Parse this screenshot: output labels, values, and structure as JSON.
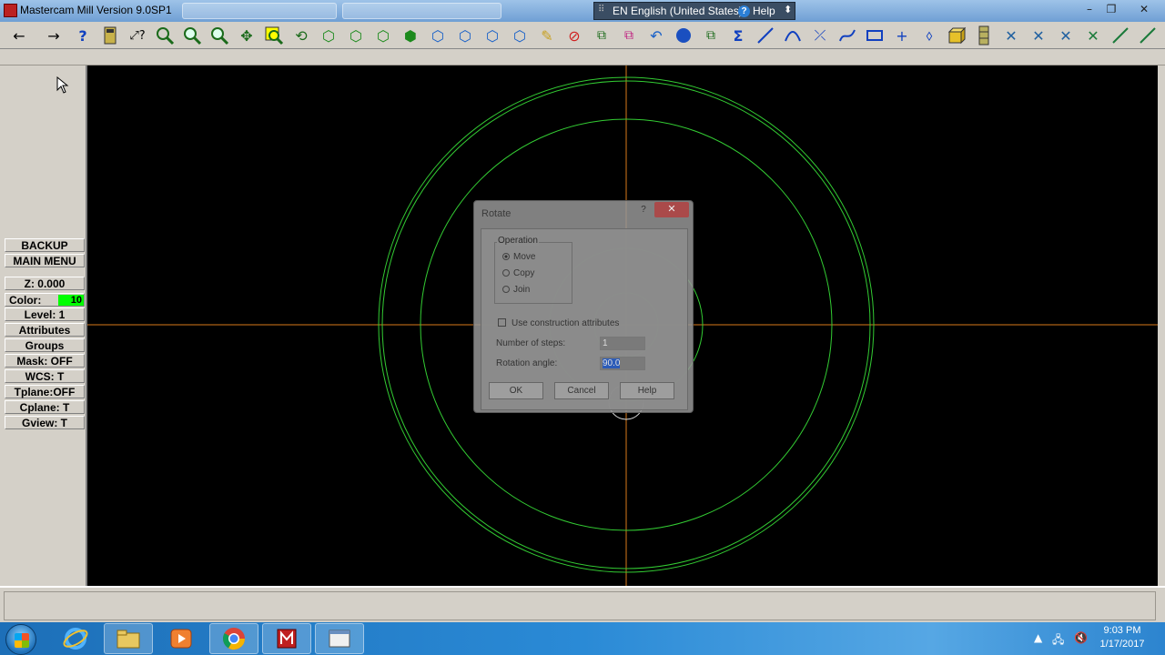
{
  "window": {
    "title": "Mastercam Mill Version 9.0SP1",
    "language": "EN English (United States)",
    "help": "Help",
    "controls": [
      "minimize-icon",
      "restore-icon",
      "close-icon"
    ]
  },
  "toolbar": {
    "icons": [
      "back-arrow-icon",
      "forward-arrow-icon",
      "help-question-icon",
      "calculator-icon",
      "analyze-icon",
      "zoom-window-icon",
      "zoom-in-icon",
      "zoom-out-icon",
      "pan-icon",
      "zoom-select-icon",
      "view-rotate-icon",
      "cube-top-icon",
      "cube-front-icon",
      "cube-side-icon",
      "cube-iso-icon",
      "cube-blue-1-icon",
      "cube-blue-2-icon",
      "cube-blue-3-icon",
      "cube-outline-icon",
      "eraser-icon",
      "no-delete-icon",
      "transform-icon",
      "transform-2-icon",
      "undo-icon",
      "sphere-icon",
      "group-icon",
      "sum-icon",
      "line-icon",
      "arc-icon",
      "trim-icon",
      "spline-icon",
      "rectangle-icon",
      "point-icon",
      "surface-icon",
      "solid-box-icon",
      "chain-icon",
      "x-cross-1-icon",
      "x-cross-2-icon",
      "x-cross-3-icon",
      "x-cross-4-icon",
      "line-angle-icon",
      "line-angle-2-icon"
    ]
  },
  "sidemenu": {
    "backup": "BACKUP",
    "main_menu": "MAIN MENU",
    "z": "Z:  0.000",
    "color_label": "Color:",
    "color_value": "10",
    "color_hex": "#00ff00",
    "level": "Level:  1",
    "attributes": "Attributes",
    "groups": "Groups",
    "mask": "Mask:  OFF",
    "wcs": "WCS:   T",
    "tplane": "Tplane:OFF",
    "cplane": "Cplane:  T",
    "gview": "Gview:  T"
  },
  "canvas": {
    "background": "#000000",
    "geometry_color": "#33cc33",
    "axis_color": "#d97a1a"
  },
  "dialog": {
    "title": "Rotate",
    "help_symbol": "?",
    "close_symbol": "✕",
    "operation_label": "Operation",
    "options": [
      "Move",
      "Copy",
      "Join"
    ],
    "selected_option": "Move",
    "construction_attributes": "Use construction attributes",
    "steps_label": "Number of steps:",
    "steps_value": "1",
    "angle_label": "Rotation angle:",
    "angle_value": "90.0",
    "ok": "OK",
    "cancel": "Cancel",
    "help": "Help"
  },
  "taskbar": {
    "apps": [
      "internet-explorer-icon",
      "file-explorer-icon",
      "media-player-icon",
      "chrome-icon",
      "mastercam-icon",
      "window-icon"
    ],
    "time": "9:03 PM",
    "date": "1/17/2017"
  }
}
